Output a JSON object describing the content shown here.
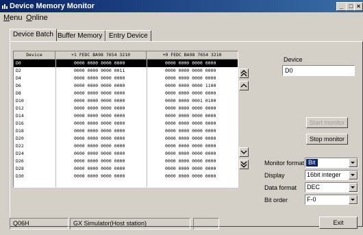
{
  "window": {
    "title": "Device Memory Monitor",
    "controls": [
      "_",
      "□",
      "×"
    ]
  },
  "menu": {
    "items": [
      {
        "label": "Menu",
        "underline": "M",
        "rest": "enu"
      },
      {
        "label": "Online",
        "underline": "O",
        "rest": "nline"
      }
    ]
  },
  "tabs": [
    "Device Batch",
    "Buffer Memory",
    "Entry Device"
  ],
  "grid": {
    "headers": [
      "Device",
      "+1  FEDC BA98 7654 3210",
      "+0  FEDC BA98 7654 3210"
    ],
    "rows": [
      {
        "device": "D0",
        "plus1": "0000 0000 0000 0000",
        "plus0": "0000 0000 0000 0000",
        "selected": true
      },
      {
        "device": "D2",
        "plus1": "0000 0000 0000 0011",
        "plus0": "0000 0000 0000 0000"
      },
      {
        "device": "D4",
        "plus1": "0000 0000 0000 0000",
        "plus0": "0000 0000 0000 0000"
      },
      {
        "device": "D6",
        "plus1": "0000 0000 0000 0000",
        "plus0": "0000 0000 0000 1100"
      },
      {
        "device": "D8",
        "plus1": "0000 0000 0000 0000",
        "plus0": "0000 0000 0000 0000"
      },
      {
        "device": "D10",
        "plus1": "0000 0000 0000 0000",
        "plus0": "0000 0000 0001 0100"
      },
      {
        "device": "D12",
        "plus1": "0000 0000 0000 0000",
        "plus0": "0000 0000 0000 0000"
      },
      {
        "device": "D14",
        "plus1": "0000 0000 0000 0000",
        "plus0": "0000 0000 0000 0000"
      },
      {
        "device": "D16",
        "plus1": "0000 0000 0000 0000",
        "plus0": "0000 0000 0000 0000"
      },
      {
        "device": "D18",
        "plus1": "0000 0000 0000 0000",
        "plus0": "0000 0000 0000 0000"
      },
      {
        "device": "D20",
        "plus1": "0000 0000 0000 0000",
        "plus0": "0000 0000 0000 0000"
      },
      {
        "device": "D22",
        "plus1": "0000 0000 0000 0000",
        "plus0": "0000 0000 0000 0000"
      },
      {
        "device": "D24",
        "plus1": "0000 0000 0000 0000",
        "plus0": "0000 0000 0000 0000"
      },
      {
        "device": "D26",
        "plus1": "0000 0000 0000 0000",
        "plus0": "0000 0000 0000 0000"
      },
      {
        "device": "D28",
        "plus1": "0000 0000 0000 0000",
        "plus0": "0000 0000 0000 0000"
      },
      {
        "device": "D30",
        "plus1": "0000 0000 0000 0000",
        "plus0": "0000 0000 0000 0000"
      }
    ]
  },
  "right_panel": {
    "device_label": "Device",
    "device_value": "D0",
    "start_monitor": "Start monitor",
    "stop_monitor": "Stop monitor",
    "monitor_format_label": "Monitor format",
    "monitor_format_value": "Bit",
    "display_label": "Display",
    "display_value": "16bit integer",
    "data_format_label": "Data format",
    "data_format_value": "DEC",
    "bit_order_label": "Bit order",
    "bit_order_value": "F-0",
    "exit": "Exit"
  },
  "status": {
    "cpu": "Q06H",
    "connection": "GX Simulator(Host station)",
    "extra": ""
  },
  "icons": [
    "app-icon",
    "scroll-top-icon",
    "scroll-up-icon",
    "scroll-down-icon",
    "scroll-bottom-icon",
    "dropdown-arrow-icon"
  ]
}
